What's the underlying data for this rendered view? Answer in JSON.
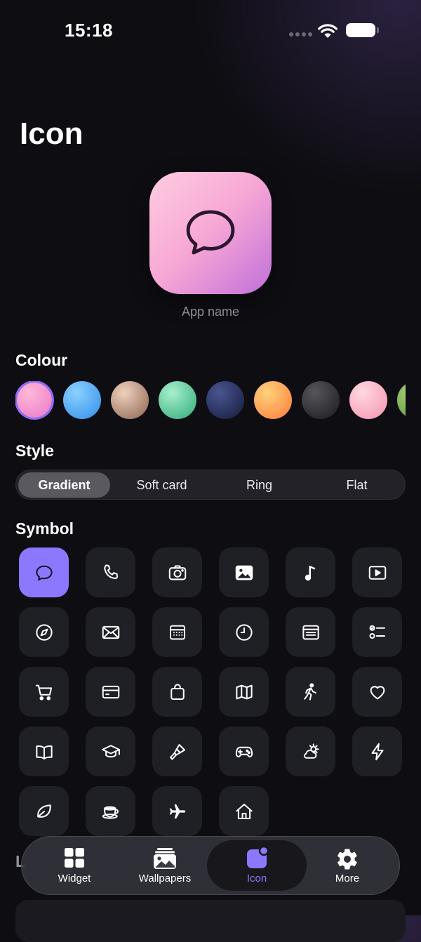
{
  "status_bar": {
    "time": "15:18"
  },
  "page": {
    "title": "Icon"
  },
  "preview": {
    "app_name": "App name",
    "symbol": "chat-bubble-icon"
  },
  "colour": {
    "title": "Colour",
    "swatches": [
      {
        "name": "pink",
        "colors": [
          "#ffb9d8",
          "#e977c7"
        ],
        "selected": true
      },
      {
        "name": "sky",
        "colors": [
          "#8bd1ff",
          "#2f8ee8"
        ]
      },
      {
        "name": "sand",
        "colors": [
          "#f0d0bd",
          "#8a6450"
        ]
      },
      {
        "name": "mint",
        "colors": [
          "#a8f0cd",
          "#2eaa78"
        ]
      },
      {
        "name": "navy",
        "colors": [
          "#4a5591",
          "#141a3a"
        ]
      },
      {
        "name": "peach",
        "colors": [
          "#ffd27a",
          "#ff7a3c"
        ]
      },
      {
        "name": "graphite",
        "colors": [
          "#55555b",
          "#1a1a1e"
        ]
      },
      {
        "name": "blush",
        "colors": [
          "#ffd9e2",
          "#f491ae"
        ]
      },
      {
        "name": "olive",
        "colors": [
          "#a6d27a",
          "#5e8f32"
        ]
      }
    ]
  },
  "style": {
    "title": "Style",
    "options": [
      "Gradient",
      "Soft card",
      "Ring",
      "Flat"
    ],
    "selected": "Gradient"
  },
  "symbol": {
    "title": "Symbol",
    "selected": "chat-bubble-icon",
    "icons": [
      "chat-bubble-icon",
      "phone-icon",
      "camera-icon",
      "photo-icon",
      "music-note-icon",
      "play-video-icon",
      "compass-icon",
      "mail-icon",
      "calendar-icon",
      "clock-icon",
      "news-icon",
      "checklist-icon",
      "cart-icon",
      "credit-card-icon",
      "shopping-bag-icon",
      "map-icon",
      "walking-icon",
      "heart-icon",
      "book-icon",
      "graduation-cap-icon",
      "paintbrush-icon",
      "gamepad-icon",
      "cloud-sun-icon",
      "bolt-icon",
      "leaf-icon",
      "coffee-cup-icon",
      "airplane-icon",
      "home-icon"
    ]
  },
  "tab_bar": {
    "items": [
      {
        "label": "Widget",
        "icon": "widget-grid-icon"
      },
      {
        "label": "Wallpapers",
        "icon": "wallpapers-icon"
      },
      {
        "label": "Icon",
        "icon": "app-icon-icon",
        "active": true
      },
      {
        "label": "More",
        "icon": "gear-icon"
      }
    ],
    "accent": "#8b78ff"
  }
}
